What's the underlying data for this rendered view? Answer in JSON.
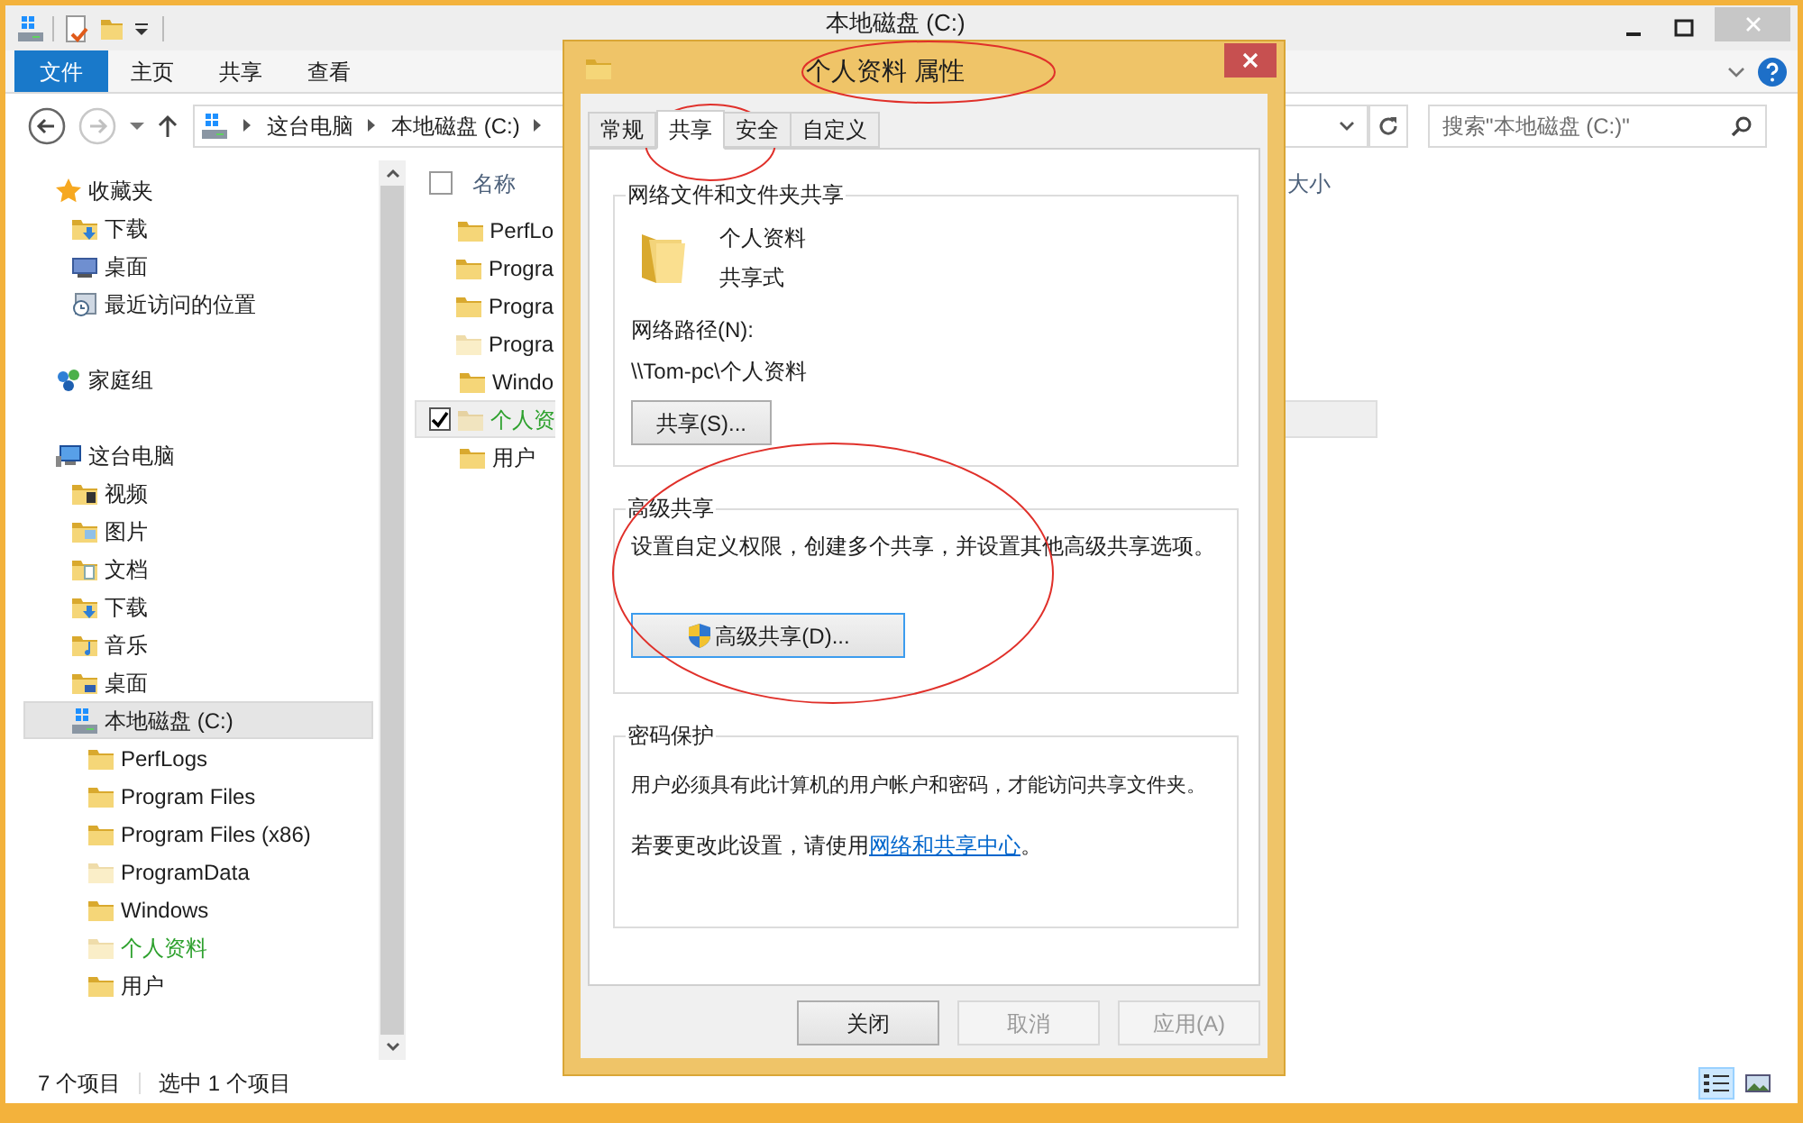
{
  "explorer": {
    "title": "本地磁盘 (C:)",
    "ribbon_tabs": [
      {
        "label": "文件",
        "kind": "file_menu"
      },
      {
        "label": "主页",
        "kind": "tab"
      },
      {
        "label": "共享",
        "kind": "tab"
      },
      {
        "label": "查看",
        "kind": "tab"
      }
    ],
    "address": {
      "segments": [
        "这台电脑",
        "本地磁盘 (C:)"
      ]
    },
    "search": {
      "placeholder": "搜索\"本地磁盘 (C:)\""
    },
    "navigation": [
      {
        "label": "收藏夹",
        "kind": "star",
        "selected": false,
        "children": [
          {
            "label": "下载",
            "kind": "downloads",
            "selected": false
          },
          {
            "label": "桌面",
            "kind": "desktop",
            "selected": false
          },
          {
            "label": "最近访问的位置",
            "kind": "recent",
            "selected": false
          }
        ]
      },
      {
        "label": "家庭组",
        "kind": "homegroup",
        "selected": false
      },
      {
        "label": "这台电脑",
        "kind": "pc",
        "selected": false,
        "children": [
          {
            "label": "视频",
            "kind": "videos",
            "selected": false
          },
          {
            "label": "图片",
            "kind": "pictures",
            "selected": false
          },
          {
            "label": "文档",
            "kind": "documents",
            "selected": false
          },
          {
            "label": "下载",
            "kind": "downloads",
            "selected": false
          },
          {
            "label": "音乐",
            "kind": "music",
            "selected": false
          },
          {
            "label": "桌面",
            "kind": "desktop_folder",
            "selected": false
          },
          {
            "label": "本地磁盘 (C:)",
            "kind": "drive",
            "selected": true,
            "children": [
              {
                "label": "PerfLogs",
                "kind": "folder",
                "selected": false,
                "hidden": false,
                "encrypted": false
              },
              {
                "label": "Program Files",
                "kind": "folder",
                "selected": false,
                "hidden": false,
                "encrypted": false
              },
              {
                "label": "Program Files (x86)",
                "kind": "folder",
                "selected": false,
                "hidden": false,
                "encrypted": false
              },
              {
                "label": "ProgramData",
                "kind": "folder",
                "selected": false,
                "hidden": true,
                "encrypted": false
              },
              {
                "label": "Windows",
                "kind": "folder",
                "selected": false,
                "hidden": false,
                "encrypted": false
              },
              {
                "label": "个人资料",
                "kind": "folder",
                "selected": false,
                "hidden": true,
                "encrypted": true
              },
              {
                "label": "用户",
                "kind": "folder",
                "selected": false,
                "hidden": false,
                "encrypted": false
              }
            ]
          }
        ]
      }
    ],
    "select_all": {
      "checked": false
    },
    "columns": [
      "名称",
      "大小"
    ],
    "files": [
      {
        "name": "PerfLo",
        "hidden": false,
        "encrypted": false,
        "selected": false,
        "checked": false
      },
      {
        "name": "Progra",
        "hidden": false,
        "encrypted": false,
        "selected": false,
        "checked": false
      },
      {
        "name": "Progra",
        "hidden": false,
        "encrypted": false,
        "selected": false,
        "checked": false
      },
      {
        "name": "Progra",
        "hidden": true,
        "encrypted": false,
        "selected": false,
        "checked": false
      },
      {
        "name": "Windo",
        "hidden": false,
        "encrypted": false,
        "selected": false,
        "checked": false
      },
      {
        "name": "个人资",
        "hidden": true,
        "encrypted": true,
        "selected": true,
        "checked": true
      },
      {
        "name": "用户",
        "hidden": false,
        "encrypted": false,
        "selected": false,
        "checked": false
      }
    ],
    "status": [
      "7 个项目",
      "选中 1 个项目"
    ],
    "views": [
      {
        "kind": "details",
        "selected": true
      },
      {
        "kind": "thumbnails",
        "selected": false
      }
    ]
  },
  "dialog": {
    "title": "个人资料 属性",
    "tabs": [
      {
        "label": "常规",
        "selected": false
      },
      {
        "label": "共享",
        "selected": true
      },
      {
        "label": "安全",
        "selected": false
      },
      {
        "label": "自定义",
        "selected": false
      }
    ],
    "network_sharing": {
      "legend": "网络文件和文件夹共享",
      "name": "个人资料",
      "state": "共享式",
      "path_label": "网络路径(N):",
      "path": "\\\\Tom-pc\\个人资料",
      "button": "共享(S)..."
    },
    "advanced": {
      "legend": "高级共享",
      "text": "设置自定义权限，创建多个共享，并设置其他高级共享选项。",
      "button": "高级共享(D)..."
    },
    "password": {
      "legend": "密码保护",
      "text": "用户必须具有此计算机的用户帐户和密码，才能访问共享文件夹。",
      "note": "若要更改此设置，请使用",
      "link": "网络和共享中心",
      "note_end": "。"
    },
    "buttons": [
      {
        "label": "关闭",
        "disabled": false
      },
      {
        "label": "取消",
        "disabled": true
      },
      {
        "label": "应用(A)",
        "disabled": true
      }
    ]
  }
}
